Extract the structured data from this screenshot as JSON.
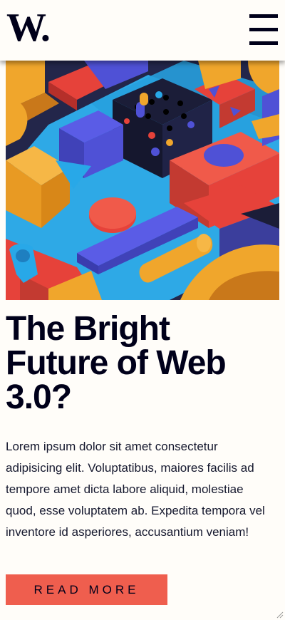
{
  "header": {
    "logo": "W.",
    "menu_icon": "hamburger-menu-icon"
  },
  "hero": {
    "image": "colorful-3d-geometric-blocks-illustration"
  },
  "article": {
    "title": "The Bright Future of Web 3.0?",
    "body": "Lorem ipsum dolor sit amet consectetur adipisicing elit. Voluptatibus, maiores facilis ad tempore amet dicta labore aliquid, molestiae quod, esse voluptatem ab. Expedita tempora vel inventore id asperiores, accusantium veniam!",
    "button_label": "READ MORE"
  },
  "colors": {
    "background": "#fffdf9",
    "text": "#00001a",
    "accent": "#ef5e4e",
    "blue": "#4f51d6",
    "orange": "#f0a62c",
    "red": "#e6423a",
    "cyan": "#28a8e8"
  }
}
